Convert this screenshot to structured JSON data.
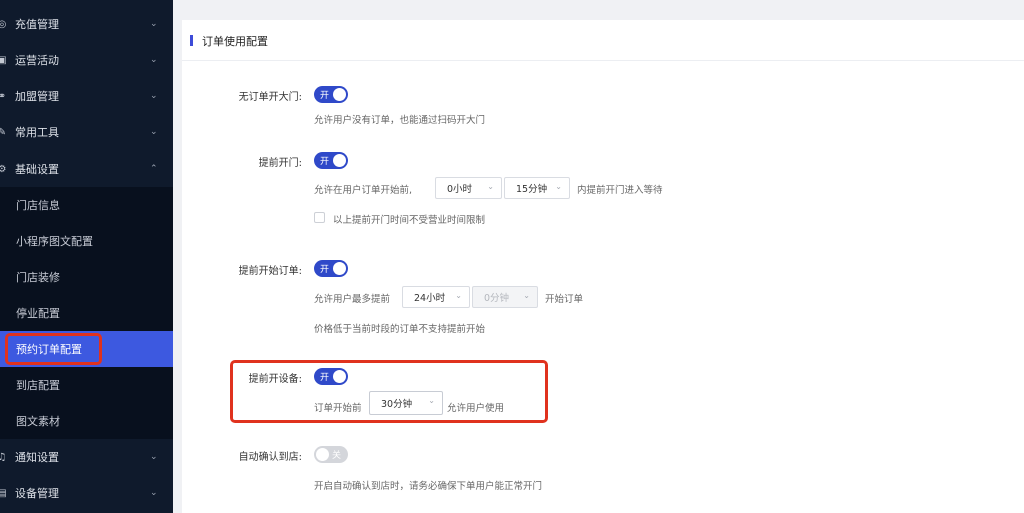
{
  "sidebar": {
    "groups_top": [
      {
        "label": "充值管理",
        "icon": "recharge-icon"
      },
      {
        "label": "运营活动",
        "icon": "campaign-icon"
      },
      {
        "label": "加盟管理",
        "icon": "franchise-icon"
      },
      {
        "label": "常用工具",
        "icon": "tool-icon"
      },
      {
        "label": "基础设置",
        "icon": "settings-gear-icon"
      }
    ],
    "sub_items": [
      {
        "label": "门店信息"
      },
      {
        "label": "小程序图文配置"
      },
      {
        "label": "门店装修"
      },
      {
        "label": "停业配置"
      },
      {
        "label": "预约订单配置"
      },
      {
        "label": "到店配置"
      },
      {
        "label": "图文素材"
      }
    ],
    "groups_bottom": [
      {
        "label": "通知设置",
        "icon": "bell-icon"
      },
      {
        "label": "设备管理",
        "icon": "device-icon"
      }
    ],
    "active_item": "预约订单配置"
  },
  "section": {
    "title": "订单使用配置"
  },
  "fields": {
    "no_order_open": {
      "label": "无订单开大门:",
      "toggle": "开",
      "help": "允许用户没有订单，也能通过扫码开大门"
    },
    "early_open": {
      "label": "提前开门:",
      "toggle": "开",
      "prefix": "允许在用户订单开始前,",
      "hour": "0小时",
      "minute": "15分钟",
      "suffix": "内提前开门进入等待",
      "checkbox_label": "以上提前开门时间不受营业时间限制"
    },
    "early_start": {
      "label": "提前开始订单:",
      "toggle": "开",
      "prefix": "允许用户最多提前",
      "hour": "24小时",
      "minute": "0分钟",
      "suffix": "开始订单",
      "help": "价格低于当前时段的订单不支持提前开始"
    },
    "early_device": {
      "label": "提前开设备:",
      "toggle": "开",
      "prefix": "订单开始前",
      "minute": "30分钟",
      "suffix": "允许用户使用"
    },
    "auto_confirm": {
      "label": "自动确认到店:",
      "toggle": "关",
      "help": "开启自动确认到店时，请务必确保下单用户能正常开门"
    }
  },
  "colors": {
    "sidebar_bg": "#0f1a2c",
    "accent": "#3d59e0",
    "toggle_on": "#2f49c9",
    "highlight": "#e0321e"
  }
}
